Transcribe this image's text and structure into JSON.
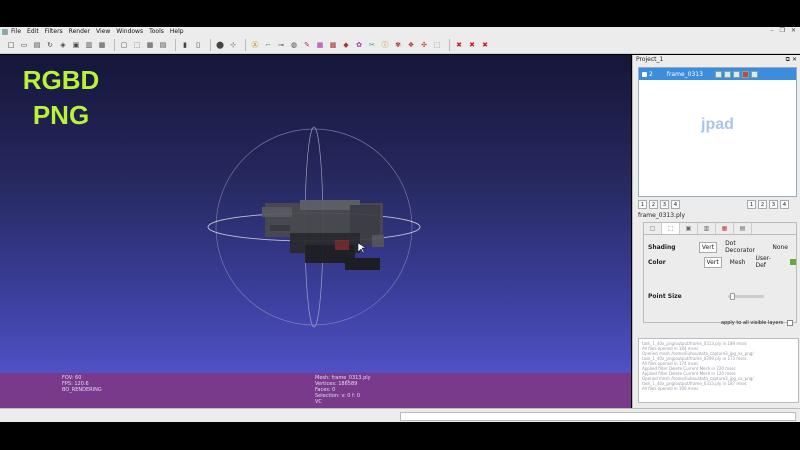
{
  "menubar": {
    "items": [
      "File",
      "Edit",
      "Filters",
      "Render",
      "View",
      "Windows",
      "Tools",
      "Help"
    ]
  },
  "toolbar": {
    "icons": [
      "new-icon",
      "open-icon",
      "save-icon",
      "reload-icon",
      "snapshot-icon",
      "export-icon",
      "layers-icon",
      "view-icon",
      "lighting-icon",
      "perspective-icon",
      "trackball-icon",
      "settings-icon",
      "shade-icon",
      "box-icon",
      "pointcloud-icon",
      "axis-icon",
      "annotate-icon",
      "brush-icon",
      "measure-icon",
      "color-icon",
      "edit-icon",
      "select-icon",
      "paint-icon",
      "info-icon",
      "pick-icon",
      "select2-icon",
      "erase-icon",
      "delete-icon",
      "delete2-icon",
      "delete3-icon"
    ]
  },
  "viewport": {
    "overlay_line1": "RGBD",
    "overlay_line2": "PNG",
    "info_left": [
      "FOV: 60",
      "FPS:   120.6",
      "BO_RENDERING"
    ],
    "info_right": [
      "Mesh: frame_0313.ply",
      "Vertices: 186589",
      "Faces: 0",
      "Selection: v: 0 f: 0",
      "VC"
    ]
  },
  "panel": {
    "title": "Project_1",
    "layer": {
      "number": "2",
      "name": "frame_0313"
    },
    "watermark": "jpad",
    "pager_left": [
      "1",
      "2",
      "3",
      "4"
    ],
    "pager_right": [
      "1",
      "2",
      "3",
      "4"
    ],
    "filename": "frame_0313.ply",
    "shading_label": "Shading",
    "shading_options": [
      "Vert",
      "Dot Decorator",
      "None"
    ],
    "color_label": "Color",
    "color_options": [
      "Vert",
      "Mesh",
      "User-Def"
    ],
    "color_swatch": "#6aa83a",
    "point_size_label": "Point Size",
    "point_size_value": 0.05,
    "apply_label": "apply to all visible layers"
  },
  "log": [
    "task_1_40x_png/output/frame_0313.ply in 189 msec",
    "All files opened in 184 msec",
    "Opened mesh /home/liuhou/data_capture3_jpg_vx_png/",
    "task_1_40x_png/output/frame_0299.ply in 173 msec",
    "All files opened in 174 msec",
    "Applied filter Delete Current Mesh in 220 msec",
    "Applied filter Delete Current Mesh in 120 msec",
    "Opened mesh /home/liuhou/data_capture3_jpg_vx_png/",
    "task_1_40x_png/output/frame_0313.ply in 187 msec",
    "All files opened in 190 msec"
  ],
  "colors": {
    "overlay_text": "#b8f23a",
    "selection": "#3c8dde",
    "info_bar": "#7a3a8c"
  }
}
